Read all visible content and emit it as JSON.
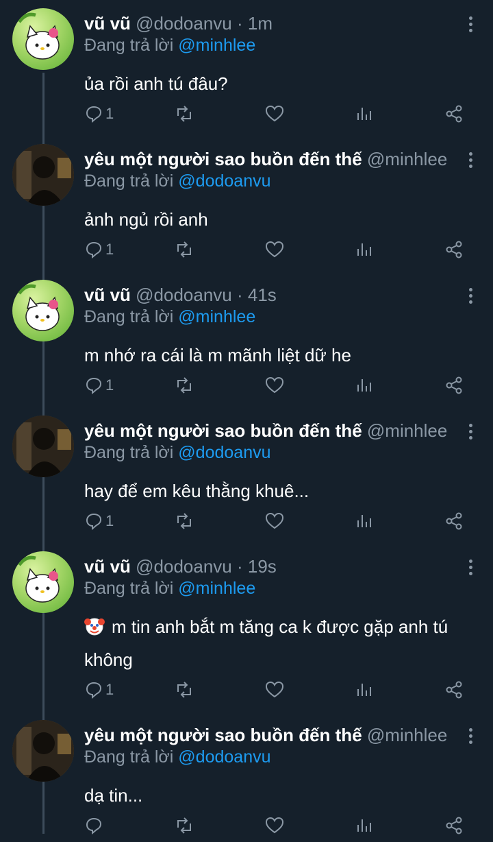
{
  "tweets": [
    {
      "name": "vũ vũ",
      "handle": "@dodoanvu · 1m",
      "reply_prefix": "Đang trả lời",
      "reply_mention": "@minhlee",
      "text": "ủa rồi anh tú đâu?",
      "reply_count": "1",
      "avatar": "hello-kitty-avatar"
    },
    {
      "name": "yêu một người sao buồn đến thế",
      "handle": "@minhlee ·...",
      "reply_prefix": "Đang trả lời",
      "reply_mention": "@dodoanvu",
      "text": "ảnh ngủ rồi anh",
      "reply_count": "1",
      "avatar": "dark-photo-avatar"
    },
    {
      "name": "vũ vũ",
      "handle": "@dodoanvu · 41s",
      "reply_prefix": "Đang trả lời",
      "reply_mention": "@minhlee",
      "text": "m nhớ ra cái là m mãnh liệt dữ he",
      "reply_count": "1",
      "avatar": "hello-kitty-avatar"
    },
    {
      "name": "yêu một người sao buồn đến thế",
      "handle": "@minhlee ·...",
      "reply_prefix": "Đang trả lời",
      "reply_mention": "@dodoanvu",
      "text": "hay để em kêu thằng khuê...",
      "reply_count": "1",
      "avatar": "dark-photo-avatar"
    },
    {
      "name": "vũ vũ",
      "handle": "@dodoanvu · 19s",
      "reply_prefix": "Đang trả lời",
      "reply_mention": "@minhlee",
      "text": "m tin anh bắt m tăng ca k được gặp anh tú không",
      "emoji": "clown-face-emoji",
      "reply_count": "1",
      "avatar": "hello-kitty-avatar"
    },
    {
      "name": "yêu một người sao buồn đến thế",
      "handle": "@minhlee ·...",
      "reply_prefix": "Đang trả lời",
      "reply_mention": "@dodoanvu",
      "text": "dạ tin...",
      "reply_count": "",
      "avatar": "dark-photo-avatar"
    }
  ],
  "icons": {
    "reply": "reply-icon",
    "retweet": "retweet-icon",
    "like": "heart-icon",
    "views": "views-icon",
    "share": "share-icon",
    "more": "more-options-icon"
  },
  "colors": {
    "background": "#15202b",
    "secondary_text": "#8b98a5",
    "mention": "#1d9bf0",
    "thread_line": "#3d4c5b"
  }
}
